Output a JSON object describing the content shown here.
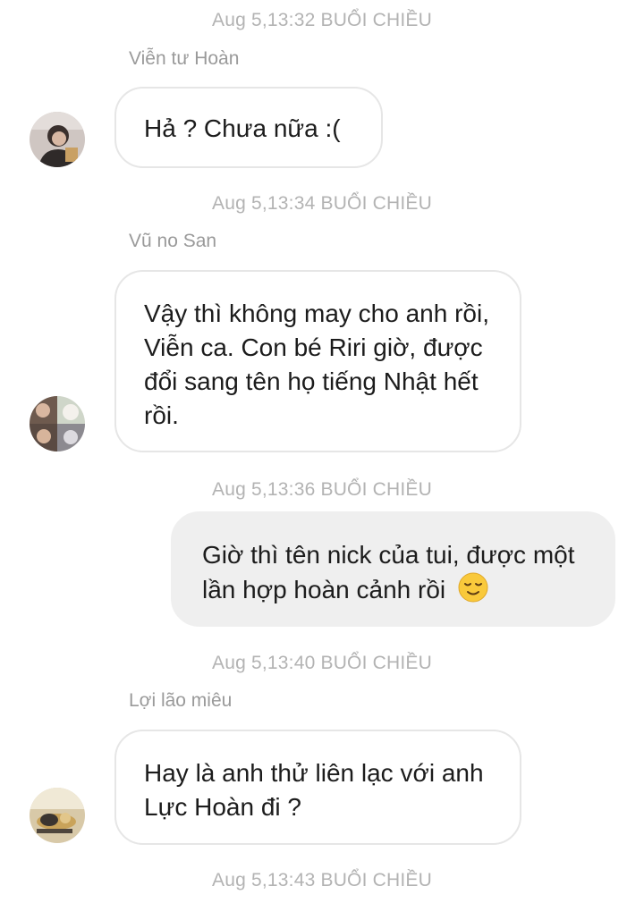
{
  "messages": [
    {
      "timestamp": "Aug 5,13:32 BUỔI CHIỀU",
      "sender": "Viễn tư Hoàn",
      "text": "Hả ? Chưa nữa :(",
      "direction": "incoming",
      "avatar_icon": "user-avatar-icon"
    },
    {
      "timestamp": "Aug 5,13:34 BUỔI CHIỀU",
      "sender": "Vũ no San",
      "text": "Vậy thì không may cho anh rồi, Viễn ca. Con bé Riri giờ, được đổi sang tên họ tiếng Nhật hết rồi.",
      "direction": "incoming",
      "avatar_icon": "user-avatar-collage-icon"
    },
    {
      "timestamp": "Aug 5,13:36 BUỔI CHIỀU",
      "text": "Giờ thì tên nick của tui, được một lần hợp hoàn cảnh rồi",
      "emoji": "relieved-face-emoji",
      "direction": "outgoing"
    },
    {
      "timestamp": "Aug 5,13:40 BUỔI CHIỀU",
      "sender": "Lợi lão miêu",
      "text": "Hay là anh thử liên lạc với anh Lực Hoàn đi ?",
      "direction": "incoming",
      "avatar_icon": "cat-avatar-icon"
    },
    {
      "timestamp": "Aug 5,13:43 BUỔI CHIỀU"
    }
  ],
  "colors": {
    "timestamp": "#b3b3b3",
    "sender": "#9a9a9a",
    "incoming_bubble_border": "#e6e6e6",
    "outgoing_bubble_bg": "#efefef",
    "message_text": "#1c1c1c"
  }
}
